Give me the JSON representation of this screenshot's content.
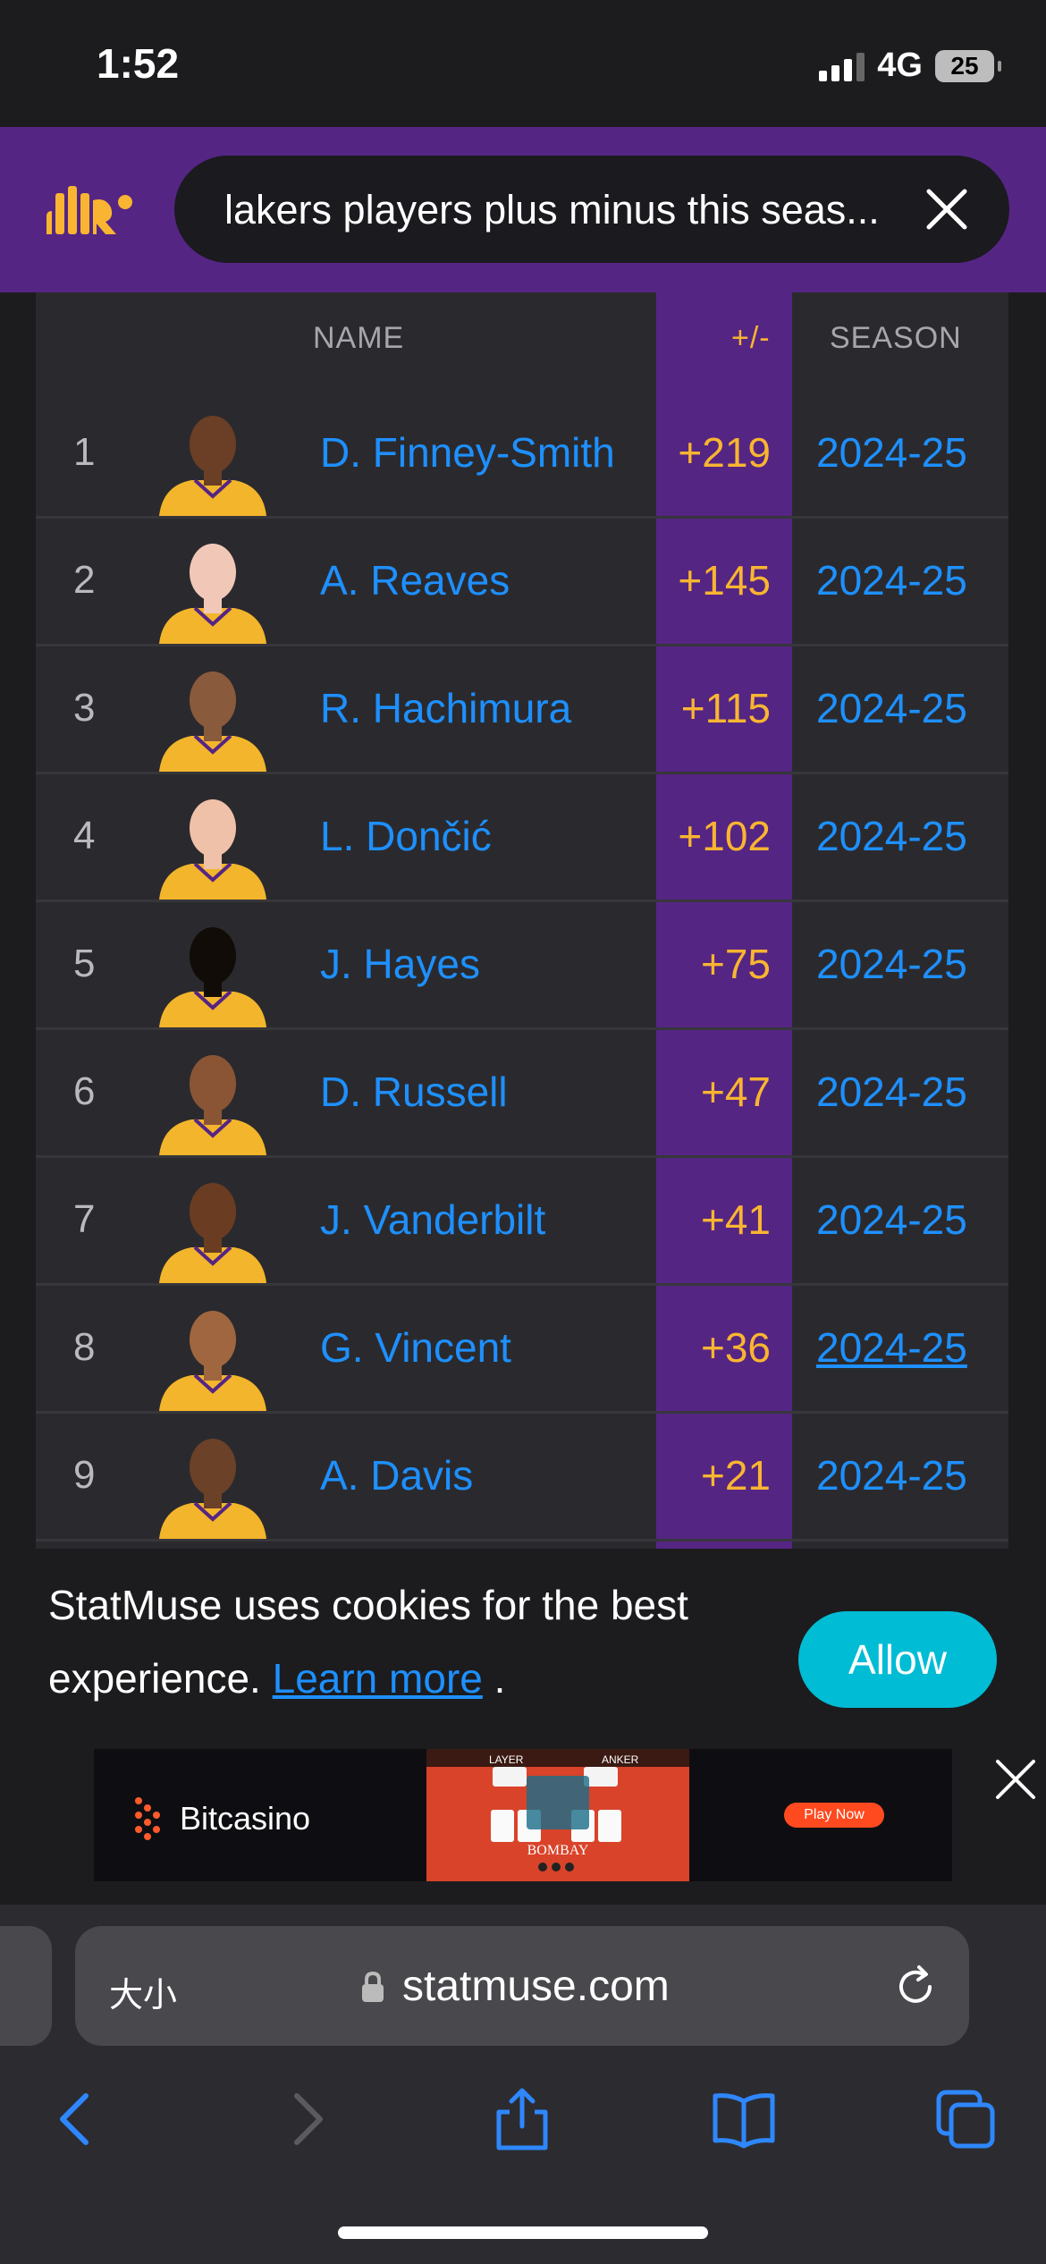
{
  "status": {
    "time": "1:52",
    "network": "4G",
    "battery": "25"
  },
  "search": {
    "query": "lakers players plus minus this seas..."
  },
  "table": {
    "headers": {
      "name": "NAME",
      "pm": "+/-",
      "season": "SEASON"
    },
    "rows": [
      {
        "rank": "1",
        "name": "D. Finney-Smith",
        "pm": "+219",
        "season": "2024-25",
        "skin": "#6b3e26"
      },
      {
        "rank": "2",
        "name": "A. Reaves",
        "pm": "+145",
        "season": "2024-25",
        "skin": "#f1c8b8"
      },
      {
        "rank": "3",
        "name": "R. Hachimura",
        "pm": "+115",
        "season": "2024-25",
        "skin": "#8a5a3c"
      },
      {
        "rank": "4",
        "name": "L. Dončić",
        "pm": "+102",
        "season": "2024-25",
        "skin": "#efc1a8"
      },
      {
        "rank": "5",
        "name": "J. Hayes",
        "pm": "+75",
        "season": "2024-25",
        "skin": "#120c08"
      },
      {
        "rank": "6",
        "name": "D. Russell",
        "pm": "+47",
        "season": "2024-25",
        "skin": "#8a5535"
      },
      {
        "rank": "7",
        "name": "J. Vanderbilt",
        "pm": "+41",
        "season": "2024-25",
        "skin": "#6a3d22"
      },
      {
        "rank": "8",
        "name": "G. Vincent",
        "pm": "+36",
        "season": "2024-25",
        "skin": "#a0663f"
      },
      {
        "rank": "9",
        "name": "A. Davis",
        "pm": "+21",
        "season": "2024-25",
        "skin": "#6b4128"
      }
    ]
  },
  "cookie": {
    "text": "StatMuse uses cookies for the best experience.",
    "link": "Learn more",
    "period": ".",
    "allow": "Allow"
  },
  "ad": {
    "brand": "Bitcasino",
    "cta": "Play Now",
    "img_text": "BOMBAY",
    "player": "LAYER",
    "banker": "ANKER"
  },
  "safari": {
    "text_size": "大小",
    "url": "statmuse.com"
  }
}
